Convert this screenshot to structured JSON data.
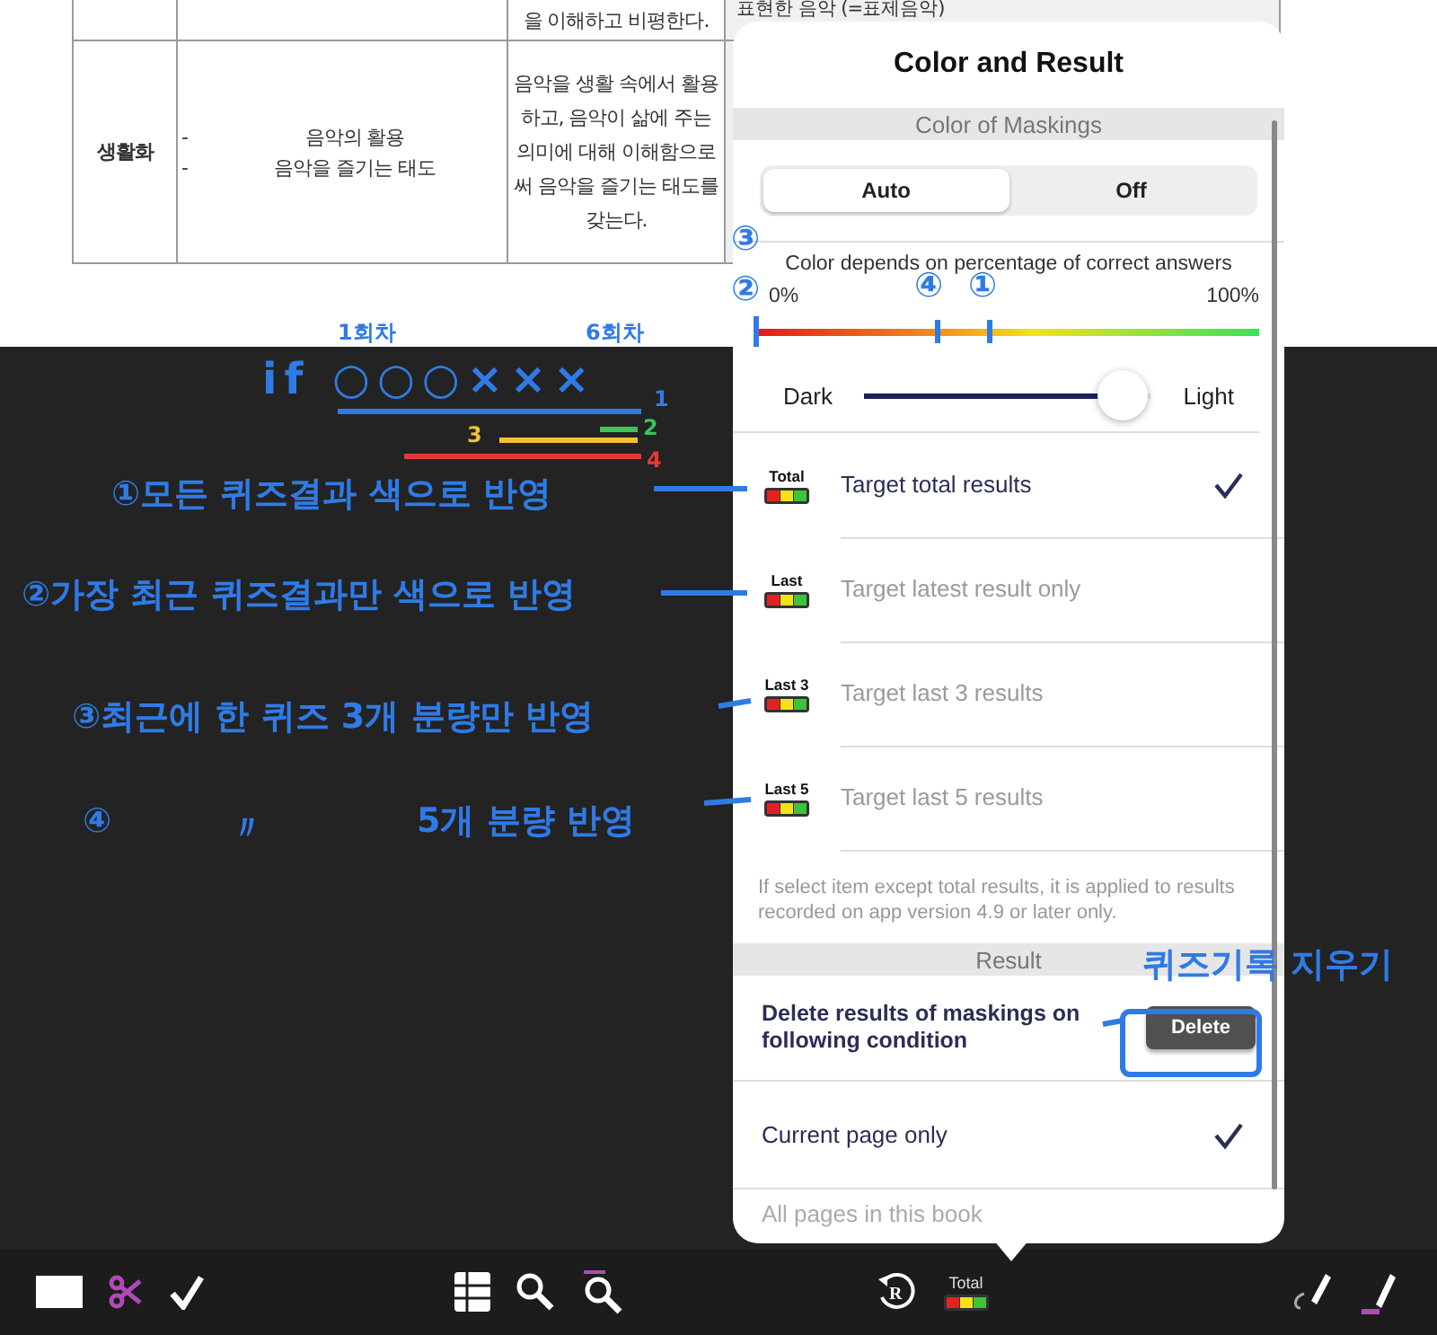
{
  "document_table": {
    "rows": [
      {
        "standard": "을 이해하고 비평한다.",
        "column_4": "표현한 음악 (=표제음악)"
      },
      {
        "area": "생활화",
        "content_items": [
          {
            "bullet": "-",
            "text": "음악의 활용"
          },
          {
            "bullet": "-",
            "text": "음악을 즐기는 태도"
          }
        ],
        "standard": "음악을 생활 속에서 활용하고, 음악이 삶에 주는 의미에 대해 이해함으로써 음악을 즐기는 태도를 갖는다."
      }
    ]
  },
  "popover": {
    "title": "Color and Result",
    "color_section": {
      "header": "Color of Maskings",
      "mode_tabs": [
        {
          "label": "Auto",
          "selected": true
        },
        {
          "label": "Off",
          "selected": false
        }
      ],
      "caption": "Color depends on percentage of correct answers",
      "scale_min": "0%",
      "scale_max": "100%",
      "brightness": {
        "min_label": "Dark",
        "max_label": "Light",
        "level": 0.9
      },
      "targets": [
        {
          "badge": "Total",
          "label": "Target total results",
          "selected": true
        },
        {
          "badge": "Last",
          "label": "Target latest result only",
          "selected": false
        },
        {
          "badge": "Last 3",
          "label": "Target last 3 results",
          "selected": false
        },
        {
          "badge": "Last 5",
          "label": "Target last 5 results",
          "selected": false
        }
      ],
      "note": "If select item except total results, it is applied to results recorded on app version 4.9 or later only."
    },
    "result_section": {
      "header": "Result",
      "prompt": "Delete results of maskings on following condition",
      "delete_button": "Delete",
      "scopes": [
        {
          "label": "Current page only",
          "selected": true
        },
        {
          "label": "All pages in this book",
          "selected": false
        }
      ]
    }
  },
  "toolbar": {
    "reset_icon_letter": "R",
    "results_badge": "Total"
  },
  "annotations": {
    "round_labels": [
      "1회차",
      "6회차"
    ],
    "sequence": "if ○○○×××",
    "range_marks": [
      {
        "label": "1",
        "color": "#2f7be6"
      },
      {
        "label": "3",
        "color": "#f2c230"
      },
      {
        "label": "2",
        "color": "#3cc35a"
      },
      {
        "label": "4",
        "color": "#e53935"
      }
    ],
    "notes": [
      "①모든 퀴즈결과 색으로 반영",
      "②가장 최근 퀴즈결과만 색으로 반영",
      "③최근에 한 퀴즈 3개 분량만 반영",
      "④",
      "〃",
      "5개 분량 반영"
    ],
    "scale_marks": [
      "③",
      "②",
      "④",
      "①"
    ],
    "delete_note": "퀴즈기록 지우기"
  }
}
